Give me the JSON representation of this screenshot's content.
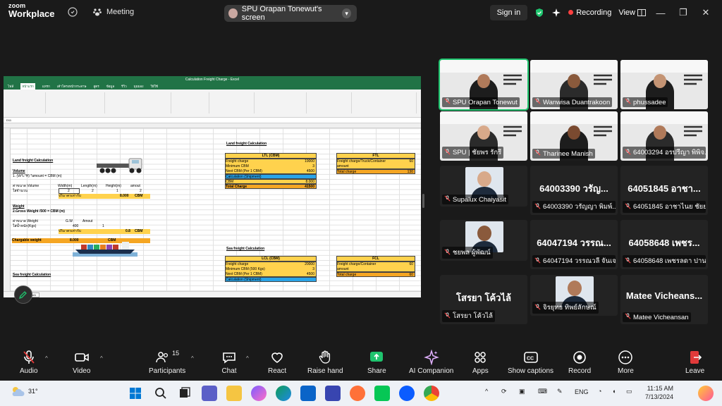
{
  "app": {
    "logo_line1": "zoom",
    "logo_line2": "Workplace",
    "meeting_label": "Meeting",
    "share_label": "SPU Orapan Tonewut's screen",
    "signin_label": "Sign in",
    "recording_label": "Recording",
    "view_label": "View"
  },
  "excel": {
    "title": "Calculation Freight Charge - Excel",
    "tabs": [
      "ไฟล์",
      "หน้าแรก",
      "แทรก",
      "เค้าโครงหน้ากระดาษ",
      "สูตร",
      "ข้อมูล",
      "รีวิว",
      "มุมมอง",
      "วิธีใช้"
    ],
    "namebox": "D11",
    "cols": [
      "B",
      "C",
      "D",
      "E",
      "F",
      "G",
      "H",
      "I",
      "J",
      "K",
      "L",
      "M",
      "N",
      "O",
      "P",
      "Q"
    ],
    "land_title": "Land freight Calculation",
    "volume_h": "Volume",
    "volume_formula": "1. (W*L*H) *amount = CBM (m)",
    "land_freight_title": "Land freight Calculation",
    "col_labels": [
      "Width(m)",
      "Length(m)",
      "Height(m)",
      "amout"
    ],
    "vol_vals": [
      "2",
      "2",
      "1",
      "2"
    ],
    "row_label1": "ค่าขนาด Volume",
    "row_label2": "ใส่จำนวน",
    "cbm_label": "ปริมาตรเท่ากับ",
    "cbm_value": "8.000",
    "cbm_unit": "CBM",
    "weight_h": "Weight",
    "weight_formula": "2.Gross Weight /500 = CBM (m)",
    "weight_label1": "ค่าขนาด Weight",
    "weight_label2": "ใส่น้ำหนัก(Kgs)",
    "gw_label": "G.W",
    "amount_label": "Amout",
    "gw_value": "400",
    "amount_value": "1",
    "weight_cbm_value": "0.8",
    "chargeable_label": "Chargable weight",
    "chargeable_value": "8.000",
    "ltl_title": "LTL (CBM)",
    "ltl_rows": [
      [
        "Freight charge",
        "19000"
      ],
      [
        "Minimum CBM",
        "3"
      ],
      [
        "Next CBM (Per 1 CBM)",
        "4500"
      ]
    ],
    "ltl_calc": "Calculation (Shipment)",
    "ltl_cbm_label": "CBM",
    "ltl_cbm_val": "8.000",
    "ltl_total_label": "Total Charge",
    "ltl_total_val": "41500",
    "ftl_title": "FTL",
    "ftl_rows": [
      "Freight charge/Truck/Container",
      "amount",
      "Total charge"
    ],
    "ftl_vals": [
      "60",
      "",
      "130"
    ],
    "sea_freight_title": "Sea freight Calculation",
    "sea_title2": "Sea freight Calculation",
    "lcl_title": "LCL (CBM)",
    "lcl_rows": [
      [
        "Freight charge",
        "20000"
      ],
      [
        "Minimum CBM (500 Kgs)",
        "3"
      ],
      [
        "Next CBM (Per 1 CBM)",
        "4500"
      ]
    ],
    "lcl_calc": "Calculation (Shipment)",
    "fcl_title": "FCL",
    "fcl_rows": [
      "Freight charge/Container",
      "amount",
      "Total charge"
    ],
    "fcl_vals": [
      "60",
      "",
      "60"
    ],
    "sheet_tab": "Worksheet1"
  },
  "participants": [
    {
      "name": "SPU Orapan Tonewut",
      "type": "video"
    },
    {
      "name": "Wanwisa Duantrakoon",
      "type": "video"
    },
    {
      "name": "phussadee",
      "type": "video"
    },
    {
      "name": "SPU | ชัยพร รักรี",
      "type": "video"
    },
    {
      "name": "Tharinee Manish",
      "type": "video"
    },
    {
      "name": "64003294 อรปรีญา พิพิจ...",
      "type": "video"
    },
    {
      "name": "Supalux Chaiyasit",
      "type": "photo"
    },
    {
      "name": "64003390 วรัญญา พิมพ์...",
      "big": "64003390 วรัญ...",
      "type": "text"
    },
    {
      "name": "64051845 อาชาไนย ชัยยา",
      "big": "64051845 อาชา...",
      "type": "text"
    },
    {
      "name": "ชยพล ผู้พัฒน์",
      "type": "photo"
    },
    {
      "name": "64047194 วรรณวลี จันเจ...",
      "big": "64047194 วรรณ...",
      "type": "text"
    },
    {
      "name": "64058648 เพชรลดา ปาน...",
      "big": "64058648 เพชร...",
      "type": "text"
    },
    {
      "name": "โสรยา โค้วไล้",
      "big": "โสรยา โค้วไล้",
      "type": "text"
    },
    {
      "name": "จิรยุทธ ทิพย์ลักษณ์",
      "type": "photo"
    },
    {
      "name": "Matee Vicheansan",
      "big": "Matee  Vicheans...",
      "type": "text"
    }
  ],
  "toolbar": {
    "audio": "Audio",
    "video": "Video",
    "participants": "Participants",
    "participants_count": "15",
    "chat": "Chat",
    "react": "React",
    "raise_hand": "Raise hand",
    "share": "Share",
    "ai_companion": "AI Companion",
    "apps": "Apps",
    "show_captions": "Show captions",
    "record": "Record",
    "more": "More",
    "leave": "Leave"
  },
  "taskbar": {
    "weather": "31°",
    "lang": "ENG",
    "time": "11:15 AM",
    "date": "7/13/2024"
  },
  "colors": {
    "zoom_green": "#1fc46e",
    "record_red": "#ff4040",
    "excel_green": "#217346",
    "leave_red": "#e03a3a"
  }
}
